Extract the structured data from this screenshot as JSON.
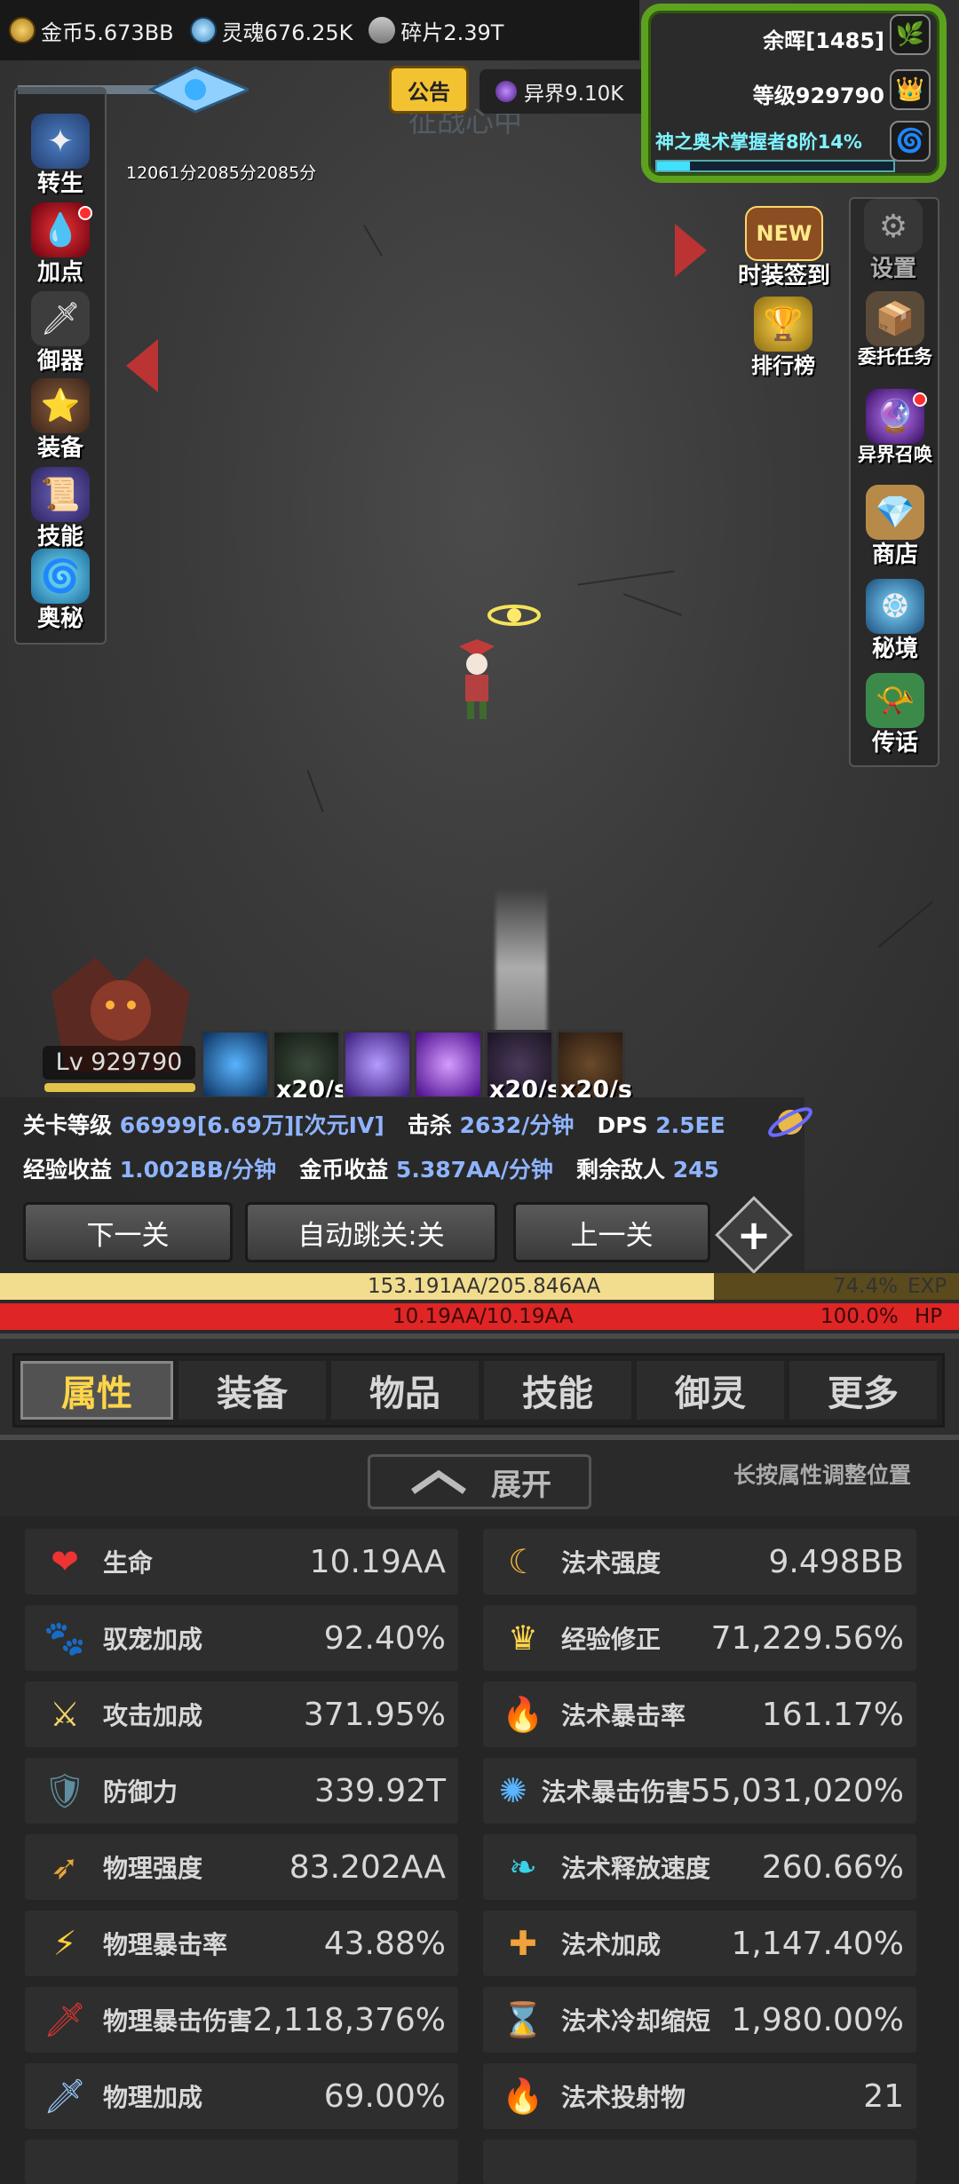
{
  "resources": {
    "gold": "金币5.673BB",
    "soul": "灵魂676.25K",
    "shard": "碎片2.39T",
    "otherworld": "异界9.10K"
  },
  "notice_label": "公告",
  "watermark": "征战心中",
  "panel": {
    "afterglow": "余晖[1485]",
    "level": "等级929790",
    "mastery": "神之奥术掌握者8阶14%",
    "mastery_progress": 0.14
  },
  "buffs": [
    "12061分",
    "2085分",
    "2085分"
  ],
  "left_menu": [
    {
      "label": "转生",
      "icon": "rebirth-icon"
    },
    {
      "label": "加点",
      "icon": "blood-drop-icon",
      "dot": true
    },
    {
      "label": "御器",
      "icon": "sword-icon"
    },
    {
      "label": "装备",
      "icon": "armor-icon"
    },
    {
      "label": "技能",
      "icon": "scroll-icon"
    },
    {
      "label": "奥秘",
      "icon": "vortex-icon"
    }
  ],
  "right_top": [
    {
      "label": "时装签到",
      "icon": "new-badge-icon",
      "badge": "NEW"
    },
    {
      "label": "设置",
      "icon": "gear-icon"
    },
    {
      "label": "排行榜",
      "icon": "trophy-icon"
    },
    {
      "label": "委托任务",
      "icon": "quest-icon"
    }
  ],
  "right_menu": [
    {
      "label": "异界召唤",
      "icon": "portal-icon",
      "dot": true
    },
    {
      "label": "商店",
      "icon": "shop-bag-icon"
    },
    {
      "label": "秘境",
      "icon": "secret-realm-icon"
    },
    {
      "label": "传话",
      "icon": "horn-icon"
    }
  ],
  "boss_level": "Lv 929790",
  "skill_rates": [
    "x20/s",
    "x20/s",
    "x20/s"
  ],
  "info": {
    "stage_label": "关卡等级",
    "stage_value": "66999[6.69万][次元IV]",
    "kills_label": "击杀",
    "kills_value": "2632/分钟",
    "dps_label": "DPS",
    "dps_value": "2.5EE",
    "exp_label": "经验收益",
    "exp_value": "1.002BB/分钟",
    "gold_label": "金币收益",
    "gold_value": "5.387AA/分钟",
    "enemies_label": "剩余敌人",
    "enemies_value": "245"
  },
  "nav": {
    "next": "下一关",
    "auto": "自动跳关:关",
    "prev": "上一关",
    "plus": "+"
  },
  "exp_bar": {
    "text": "153.191AA/205.846AA",
    "percent": "74.4%",
    "tag": "EXP",
    "fill": 0.744
  },
  "hp_bar": {
    "text": "10.19AA/10.19AA",
    "percent": "100.0%",
    "tag": "HP",
    "fill": 1.0
  },
  "tabs": [
    "属性",
    "装备",
    "物品",
    "技能",
    "御灵",
    "更多"
  ],
  "expand_label": "展开",
  "hint": "长按属性调整位置",
  "stats_left": [
    {
      "label": "生命",
      "value": "10.19AA",
      "icon": "heart-icon"
    },
    {
      "label": "驭宠加成",
      "value": "92.40%",
      "icon": "paw-icon"
    },
    {
      "label": "攻击加成",
      "value": "371.95%",
      "icon": "crossed-swords-icon"
    },
    {
      "label": "防御力",
      "value": "339.92T",
      "icon": "shield-icon"
    },
    {
      "label": "物理强度",
      "value": "83.202AA",
      "icon": "spear-icon"
    },
    {
      "label": "物理暴击率",
      "value": "43.88%",
      "icon": "crit-icon"
    },
    {
      "label": "物理暴击伤害",
      "value": "2,118,376%",
      "icon": "blood-sword-icon"
    },
    {
      "label": "物理加成",
      "value": "69.00%",
      "icon": "sword-plus-icon"
    }
  ],
  "stats_right": [
    {
      "label": "法术强度",
      "value": "9.498BB",
      "icon": "magic-claw-icon"
    },
    {
      "label": "经验修正",
      "value": "71,229.56%",
      "icon": "crown-icon"
    },
    {
      "label": "法术暴击率",
      "value": "161.17%",
      "icon": "blue-flame-icon"
    },
    {
      "label": "法术暴击伤害",
      "value": "55,031,020%",
      "icon": "magic-orb-icon"
    },
    {
      "label": "法术释放速度",
      "value": "260.66%",
      "icon": "wing-icon"
    },
    {
      "label": "法术加成",
      "value": "1,147.40%",
      "icon": "magic-plus-icon"
    },
    {
      "label": "法术冷却缩短",
      "value": "1,980.00%",
      "icon": "hourglass-icon"
    },
    {
      "label": "法术投射物",
      "value": "21",
      "icon": "purple-flame-icon"
    }
  ]
}
